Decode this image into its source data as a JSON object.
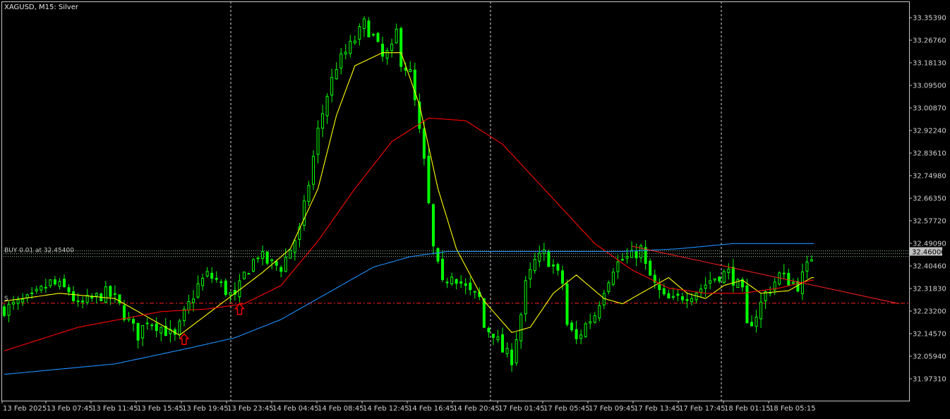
{
  "chart_title": "XAGUSD, M15:  Silver",
  "colors": {
    "background": "#000000",
    "frame": "#c8c8c8",
    "candle": "#00ff00",
    "ma_fast": "#ffff00",
    "ma_slow": "#ff0000",
    "ma_long": "#1e90ff",
    "trendline": "#ff2020",
    "level_dashed": "#ff2020",
    "order_line": "#9bbf9b",
    "price_tag_bg": "#c0c0c0",
    "arrow": "#ff0000",
    "grid_separator": "#ffffff"
  },
  "orders": {
    "buy_label": "BUY 0.01 at 32.45400",
    "sell_marker": "S"
  },
  "current_price": "32.46000",
  "chart_data": {
    "type": "candlestick",
    "symbol": "XAGUSD",
    "timeframe": "M15",
    "title": "XAGUSD, M15:  Silver",
    "ylim": [
      31.9,
      33.39
    ],
    "y_ticks": [
      "33.35390",
      "33.26760",
      "33.18130",
      "33.09500",
      "33.00870",
      "32.92240",
      "32.83610",
      "32.74980",
      "32.66350",
      "32.57720",
      "32.49090",
      "32.40460",
      "32.31830",
      "32.23200",
      "32.14570",
      "32.05940",
      "31.97310"
    ],
    "x_ticks": [
      "13 Feb 2025",
      "13 Feb 07:45",
      "13 Feb 11:45",
      "13 Feb 15:45",
      "13 Feb 19:45",
      "13 Feb 23:45",
      "14 Feb 04:45",
      "14 Feb 08:45",
      "14 Feb 12:45",
      "14 Feb 16:45",
      "14 Feb 20:45",
      "17 Feb 01:45",
      "17 Feb 05:45",
      "17 Feb 09:45",
      "17 Feb 13:45",
      "17 Feb 17:45",
      "18 Feb 01:15",
      "18 Feb 05:15"
    ],
    "day_separators": [
      "13 Feb 23:45",
      "14 Feb 20:45",
      "17 Feb 20:45"
    ],
    "close_path": [
      [
        0,
        32.24
      ],
      [
        6,
        32.28
      ],
      [
        10,
        32.34
      ],
      [
        14,
        32.31
      ],
      [
        16,
        32.25
      ],
      [
        18,
        32.27
      ],
      [
        22,
        32.3
      ],
      [
        24,
        32.28
      ],
      [
        26,
        32.22
      ],
      [
        29,
        32.14
      ],
      [
        31,
        32.2
      ],
      [
        34,
        32.17
      ],
      [
        37,
        32.13
      ],
      [
        39,
        32.22
      ],
      [
        42,
        32.33
      ],
      [
        44,
        32.37
      ],
      [
        46,
        32.35
      ],
      [
        48,
        32.31
      ],
      [
        50,
        32.28
      ],
      [
        52,
        32.37
      ],
      [
        55,
        32.45
      ],
      [
        57,
        32.42
      ],
      [
        60,
        32.4
      ],
      [
        62,
        32.47
      ],
      [
        64,
        32.54
      ],
      [
        66,
        32.72
      ],
      [
        68,
        32.92
      ],
      [
        70,
        33.06
      ],
      [
        72,
        33.17
      ],
      [
        74,
        33.22
      ],
      [
        76,
        33.27
      ],
      [
        78,
        33.33
      ],
      [
        80,
        33.28
      ],
      [
        82,
        33.2
      ],
      [
        84,
        33.23
      ],
      [
        85,
        33.3
      ],
      [
        86,
        33.19
      ],
      [
        88,
        33.14
      ],
      [
        89,
        33.03
      ],
      [
        91,
        32.8
      ],
      [
        93,
        32.47
      ],
      [
        95,
        32.33
      ],
      [
        97,
        32.38
      ],
      [
        99,
        32.34
      ],
      [
        101,
        32.3
      ],
      [
        103,
        32.28
      ],
      [
        104,
        32.17
      ],
      [
        106,
        32.15
      ],
      [
        108,
        32.08
      ],
      [
        110,
        32.05
      ],
      [
        112,
        32.22
      ],
      [
        113,
        32.33
      ],
      [
        115,
        32.42
      ],
      [
        117,
        32.45
      ],
      [
        119,
        32.4
      ],
      [
        121,
        32.34
      ],
      [
        122,
        32.18
      ],
      [
        124,
        32.12
      ],
      [
        126,
        32.18
      ],
      [
        128,
        32.22
      ],
      [
        130,
        32.32
      ],
      [
        132,
        32.4
      ],
      [
        134,
        32.43
      ],
      [
        136,
        32.44
      ],
      [
        138,
        32.47
      ],
      [
        139,
        32.4
      ],
      [
        141,
        32.33
      ],
      [
        143,
        32.28
      ],
      [
        145,
        32.27
      ],
      [
        147,
        32.29
      ],
      [
        149,
        32.3
      ],
      [
        151,
        32.32
      ],
      [
        153,
        32.35
      ],
      [
        155,
        32.37
      ],
      [
        157,
        32.38
      ],
      [
        159,
        32.33
      ],
      [
        160,
        32.3
      ],
      [
        161,
        32.17
      ],
      [
        163,
        32.22
      ],
      [
        165,
        32.3
      ],
      [
        166,
        32.32
      ],
      [
        168,
        32.37
      ],
      [
        170,
        32.35
      ],
      [
        172,
        32.33
      ],
      [
        174,
        32.4
      ],
      [
        175,
        32.44
      ]
    ],
    "series": [
      {
        "name": "MA fast",
        "color": "yellow",
        "points": [
          [
            0,
            32.27
          ],
          [
            12,
            32.3
          ],
          [
            24,
            32.28
          ],
          [
            32,
            32.2
          ],
          [
            38,
            32.14
          ],
          [
            44,
            32.22
          ],
          [
            50,
            32.3
          ],
          [
            56,
            32.38
          ],
          [
            62,
            32.47
          ],
          [
            68,
            32.7
          ],
          [
            72,
            32.98
          ],
          [
            76,
            33.17
          ],
          [
            82,
            33.22
          ],
          [
            86,
            33.22
          ],
          [
            90,
            33.02
          ],
          [
            94,
            32.7
          ],
          [
            98,
            32.47
          ],
          [
            104,
            32.27
          ],
          [
            110,
            32.15
          ],
          [
            114,
            32.17
          ],
          [
            119,
            32.3
          ],
          [
            124,
            32.37
          ],
          [
            130,
            32.28
          ],
          [
            134,
            32.26
          ],
          [
            140,
            32.32
          ],
          [
            144,
            32.36
          ],
          [
            148,
            32.3
          ],
          [
            152,
            32.28
          ],
          [
            156,
            32.33
          ],
          [
            160,
            32.35
          ],
          [
            164,
            32.3
          ],
          [
            170,
            32.31
          ],
          [
            175,
            32.36
          ]
        ]
      },
      {
        "name": "MA slow",
        "color": "red",
        "points": [
          [
            0,
            32.08
          ],
          [
            16,
            32.17
          ],
          [
            34,
            32.23
          ],
          [
            44,
            32.24
          ],
          [
            52,
            32.26
          ],
          [
            60,
            32.33
          ],
          [
            68,
            32.5
          ],
          [
            76,
            32.7
          ],
          [
            84,
            32.88
          ],
          [
            92,
            32.97
          ],
          [
            100,
            32.96
          ],
          [
            108,
            32.87
          ],
          [
            118,
            32.68
          ],
          [
            128,
            32.49
          ],
          [
            136,
            32.39
          ],
          [
            144,
            32.32
          ],
          [
            152,
            32.3
          ],
          [
            160,
            32.3
          ],
          [
            168,
            32.32
          ],
          [
            175,
            32.35
          ]
        ]
      },
      {
        "name": "MA long",
        "color": "blue",
        "points": [
          [
            0,
            31.99
          ],
          [
            12,
            32.01
          ],
          [
            24,
            32.03
          ],
          [
            32,
            32.06
          ],
          [
            40,
            32.09
          ],
          [
            50,
            32.13
          ],
          [
            60,
            32.2
          ],
          [
            70,
            32.3
          ],
          [
            80,
            32.4
          ],
          [
            88,
            32.44
          ],
          [
            96,
            32.46
          ],
          [
            108,
            32.46
          ],
          [
            120,
            32.46
          ],
          [
            134,
            32.46
          ],
          [
            146,
            32.47
          ],
          [
            158,
            32.49
          ],
          [
            170,
            32.49
          ],
          [
            175,
            32.49
          ]
        ]
      }
    ],
    "levels": [
      {
        "name": "BUY 0.01 at 32.45400",
        "value": 32.454,
        "style": "dotted"
      },
      {
        "name": "S",
        "value": 32.262,
        "style": "dash-dot"
      }
    ],
    "trendline": [
      [
        136,
        32.48
      ],
      [
        194,
        32.26
      ]
    ],
    "arrows": [
      [
        39,
        32.145
      ],
      [
        51,
        32.26
      ]
    ],
    "n_bars": 176,
    "grid": false
  }
}
